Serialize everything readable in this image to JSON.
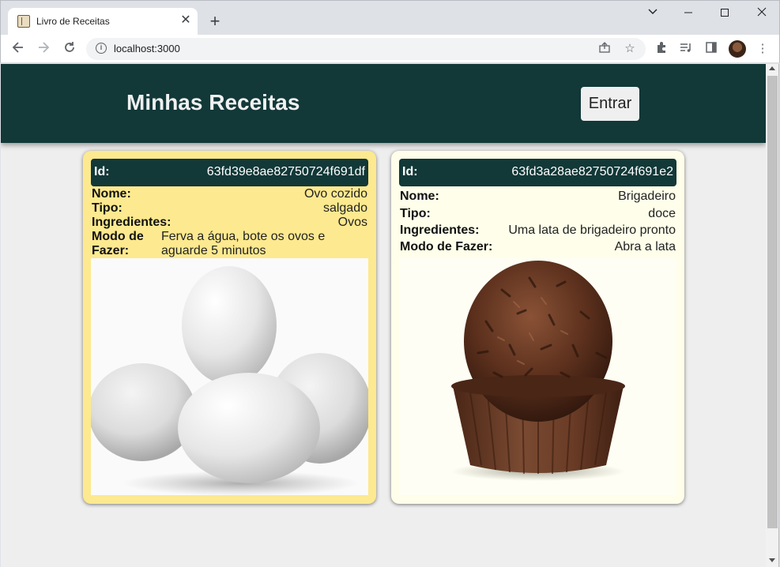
{
  "browser": {
    "tab_title": "Livro de Receitas",
    "url": "localhost:3000"
  },
  "header": {
    "title": "Minhas Receitas",
    "login_label": "Entrar"
  },
  "labels": {
    "id": "Id:",
    "nome": "Nome:",
    "tipo": "Tipo:",
    "ingredientes": "Ingredientes:",
    "modo": "Modo de Fazer:",
    "modo_line1": "Modo de",
    "modo_line2": "Fazer:"
  },
  "recipes": [
    {
      "id": "63fd39e8ae82750724f691df",
      "nome": "Ovo cozido",
      "tipo": "salgado",
      "ingredientes": "Ovos",
      "modo_line1": "Ferva a água, bote os ovos e",
      "modo_line2": "aguarde 5 minutos",
      "image": "eggs-photo",
      "card_color": "#fde98f"
    },
    {
      "id": "63fd3a28ae82750724f691e2",
      "nome": "Brigadeiro",
      "tipo": "doce",
      "ingredientes": "Uma lata de brigadeiro pronto",
      "modo": "Abra a lata",
      "image": "brigadeiro-photo",
      "card_color": "#fefeea"
    }
  ]
}
